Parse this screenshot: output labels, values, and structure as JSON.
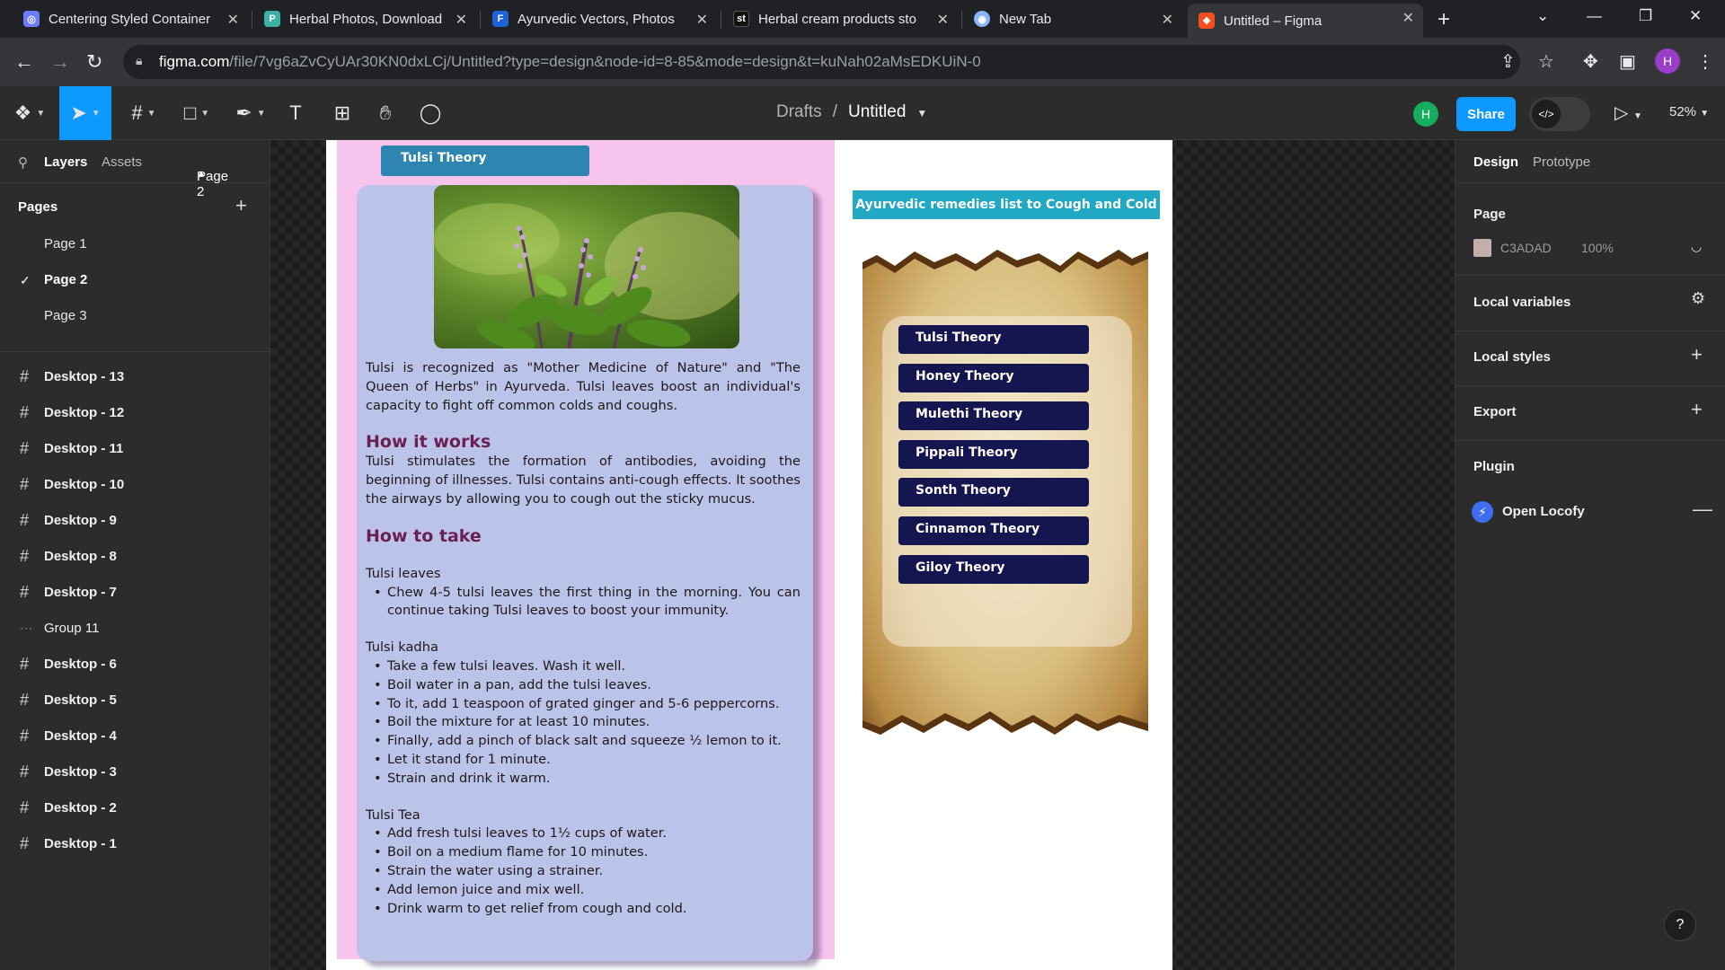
{
  "browser": {
    "tabs": [
      {
        "title": "Centering Styled Container",
        "favicon": "styled-components-icon",
        "color": "#6c7bff"
      },
      {
        "title": "Herbal Photos, Download",
        "favicon": "freepik-icon",
        "color": "#3db1a4"
      },
      {
        "title": "Ayurvedic Vectors, Photos",
        "favicon": "freepik-f-icon",
        "color": "#1e62d6"
      },
      {
        "title": "Herbal cream products sto",
        "favicon": "shutterstock-icon",
        "color": "#111111"
      },
      {
        "title": "New Tab",
        "favicon": "chrome-icon",
        "color": "#8ab4f8"
      },
      {
        "title": "Untitled – Figma",
        "favicon": "figma-icon",
        "color": "#f24e1e"
      }
    ],
    "url_host": "figma.com",
    "url_rest": "/file/7vg6aZvCyUAr30KN0dxLCj/Untitled?type=design&node-id=8-85&mode=design&t=kuNah02aMsEDKUiN-0",
    "profile_initial": "H"
  },
  "toolbar": {
    "breadcrumb_parent": "Drafts",
    "breadcrumb_sep": "/",
    "file_name": "Untitled",
    "user_initial": "H",
    "share_label": "Share",
    "zoom_label": "52%",
    "dev_mode_glyph": "</>"
  },
  "left_panel": {
    "tab_layers": "Layers",
    "tab_assets": "Assets",
    "page_selector": "Page 2",
    "pages_heading": "Pages",
    "pages": [
      "Page 1",
      "Page 2",
      "Page 3"
    ],
    "active_page": "Page 2",
    "layers": [
      {
        "name": "Desktop - 13",
        "kind": "frame"
      },
      {
        "name": "Desktop - 12",
        "kind": "frame"
      },
      {
        "name": "Desktop - 11",
        "kind": "frame"
      },
      {
        "name": "Desktop - 10",
        "kind": "frame"
      },
      {
        "name": "Desktop - 9",
        "kind": "frame"
      },
      {
        "name": "Desktop - 8",
        "kind": "frame"
      },
      {
        "name": "Desktop - 7",
        "kind": "frame"
      },
      {
        "name": "Group 11",
        "kind": "group"
      },
      {
        "name": "Desktop - 6",
        "kind": "frame"
      },
      {
        "name": "Desktop - 5",
        "kind": "frame"
      },
      {
        "name": "Desktop - 4",
        "kind": "frame"
      },
      {
        "name": "Desktop - 3",
        "kind": "frame"
      },
      {
        "name": "Desktop - 2",
        "kind": "frame"
      },
      {
        "name": "Desktop - 1",
        "kind": "frame"
      }
    ]
  },
  "canvas": {
    "badge_title": "Tulsi Theory",
    "intro": "Tulsi is recognized as \"Mother Medicine of Nature\" and \"The Queen of Herbs\" in Ayurveda. Tulsi leaves boost an individual's capacity to fight off common colds and coughs.",
    "how_works_heading": "How it works",
    "how_works_text": "Tulsi stimulates the formation of antibodies, avoiding the beginning of illnesses. Tulsi contains anti-cough effects. It soothes the airways by allowing you to cough out the sticky mucus.",
    "how_take_heading": "How to take",
    "leaves_heading": "Tulsi leaves",
    "leaves_steps": [
      "Chew 4-5 tulsi leaves the first thing in the morning. You can continue taking Tulsi leaves to boost your immunity."
    ],
    "kadha_heading": "Tulsi kadha",
    "kadha_steps": [
      "Take a few tulsi leaves. Wash it well.",
      "Boil water in a pan, add the tulsi leaves.",
      "To it, add 1 teaspoon of grated ginger and 5-6 peppercorns.",
      "Boil the mixture for at least 10 minutes.",
      "Finally, add a pinch of black salt and squeeze ½ lemon to it.",
      "Let it stand for 1 minute.",
      "Strain and drink it warm."
    ],
    "tea_heading": "Tulsi Tea",
    "tea_steps": [
      "Add fresh tulsi leaves to 1½ cups of water.",
      "Boil on a medium flame for 10 minutes.",
      "Strain the water using a strainer.",
      "Add lemon juice and mix well.",
      "Drink warm to get relief from cough and cold."
    ],
    "remedies_heading": "Ayurvedic remedies list to Cough and Cold",
    "remedies": [
      "Tulsi Theory",
      "Honey Theory",
      "Mulethi Theory",
      "Pippali Theory",
      "Sonth Theory",
      "Cinnamon Theory",
      "Giloy Theory"
    ]
  },
  "right_panel": {
    "tab_design": "Design",
    "tab_prototype": "Prototype",
    "page_heading": "Page",
    "page_color": "C3ADAD",
    "page_opacity": "100%",
    "local_variables": "Local variables",
    "local_styles": "Local styles",
    "export": "Export",
    "plugin_heading": "Plugin",
    "plugin_name": "Open Locofy",
    "help_glyph": "?"
  },
  "colors": {
    "figma_accent": "#0d99ff",
    "page_bg": "#c3adad",
    "badge_blue": "#2e86b0",
    "remedy_button": "#151550",
    "heading_plum": "#6a1f57"
  }
}
